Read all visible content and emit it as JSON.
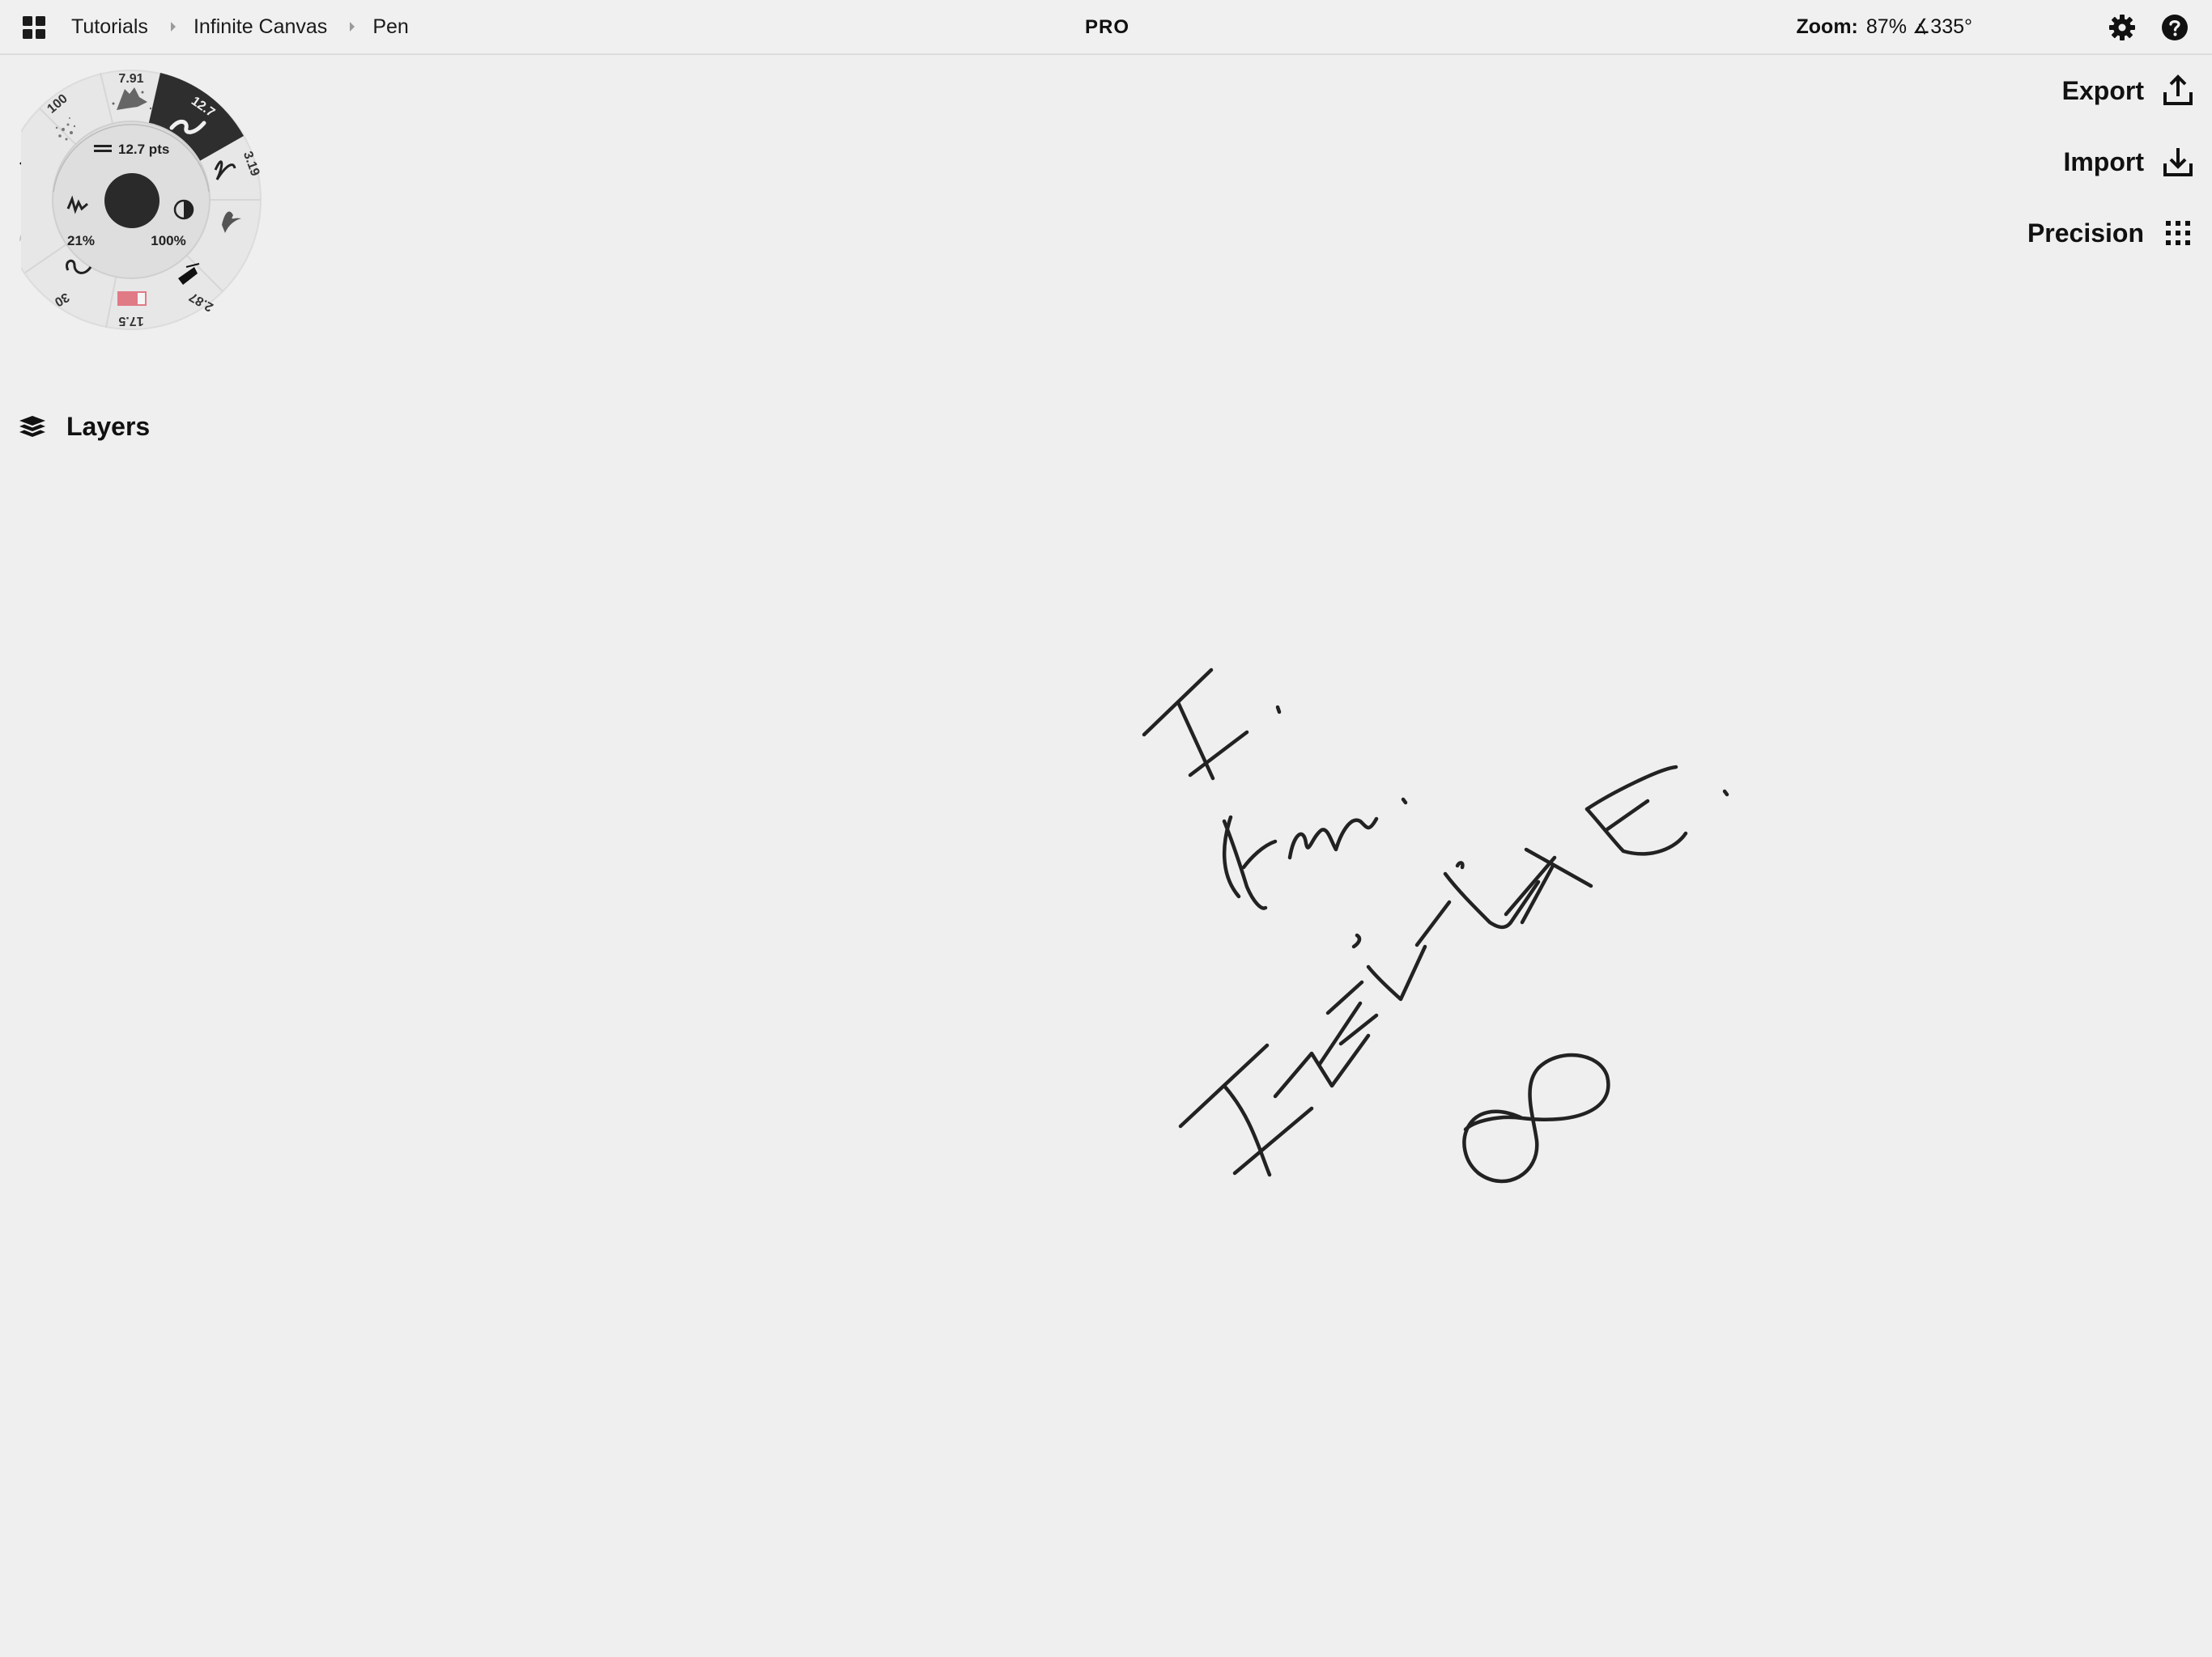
{
  "breadcrumb": {
    "items": [
      "Tutorials",
      "Infinite Canvas",
      "Pen"
    ]
  },
  "badge": "PRO",
  "zoom": {
    "label": "Zoom:",
    "value": "87% ∡335°"
  },
  "actions": {
    "export": "Export",
    "import": "Import",
    "precision": "Precision"
  },
  "layers": {
    "label": "Layers"
  },
  "tool_wheel": {
    "size_readout": "12.7 pts",
    "smoothing": "21%",
    "opacity": "100%",
    "presets": {
      "scatter": "100",
      "grain": "7.91",
      "active_size": "12.7",
      "weight": "3.19",
      "taper_end": "2.87",
      "color_swatch": "17.5",
      "taper_start": "30"
    },
    "active_color": "#e07a85"
  },
  "icons": {
    "grid": "grid-icon",
    "settings": "gear-icon",
    "help": "help-icon",
    "export": "export-icon",
    "import": "import-icon",
    "precision": "precision-grid-icon",
    "undo": "undo-icon",
    "redo": "redo-icon",
    "layers": "layers-icon"
  },
  "colors": {
    "canvas": "#efefef",
    "ink": "#222222",
    "accent": "#e07a85"
  }
}
